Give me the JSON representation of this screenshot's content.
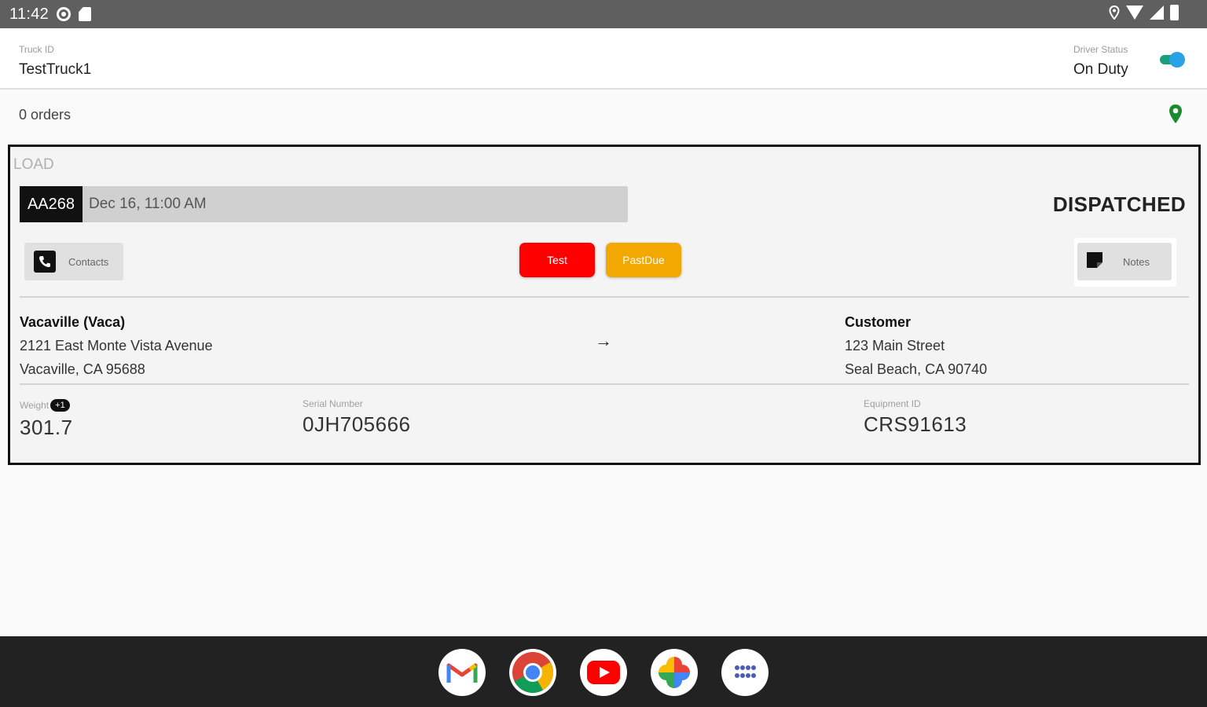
{
  "status_bar": {
    "time": "11:42"
  },
  "header": {
    "truck_label": "Truck ID",
    "truck_value": "TestTruck1",
    "driver_label": "Driver Status",
    "driver_value": "On Duty"
  },
  "orders": {
    "count_text": "0 orders"
  },
  "load": {
    "section_label": "LOAD",
    "id": "AA268",
    "datetime": "Dec 16, 11:00 AM",
    "status": "DISPATCHED",
    "contacts_label": "Contacts",
    "notes_label": "Notes",
    "tags": [
      {
        "label": "Test",
        "color": "#ff0000"
      },
      {
        "label": "PastDue",
        "color": "#f2a800"
      }
    ],
    "origin": {
      "name": "Vacaville (Vaca)",
      "line1": "2121 East Monte Vista Avenue",
      "line2": "Vacaville, CA 95688"
    },
    "destination": {
      "name": "Customer",
      "line1": "123 Main Street",
      "line2": "Seal Beach, CA 90740"
    },
    "fields": [
      {
        "label": "Weight",
        "badge": "+1",
        "value": "301.7"
      },
      {
        "label": "Serial Number",
        "value": "0JH705666"
      },
      {
        "label": "Equipment ID",
        "value": "CRS91613"
      }
    ]
  },
  "dock": {
    "apps": [
      "gmail-icon",
      "chrome-icon",
      "youtube-icon",
      "photos-icon",
      "app-drawer-icon"
    ]
  },
  "colors": {
    "status_bar": "#5f5f5f",
    "toggle_track": "#1a9e7c",
    "toggle_knob": "#29a3e6",
    "map_pin": "#1b8a2e"
  }
}
